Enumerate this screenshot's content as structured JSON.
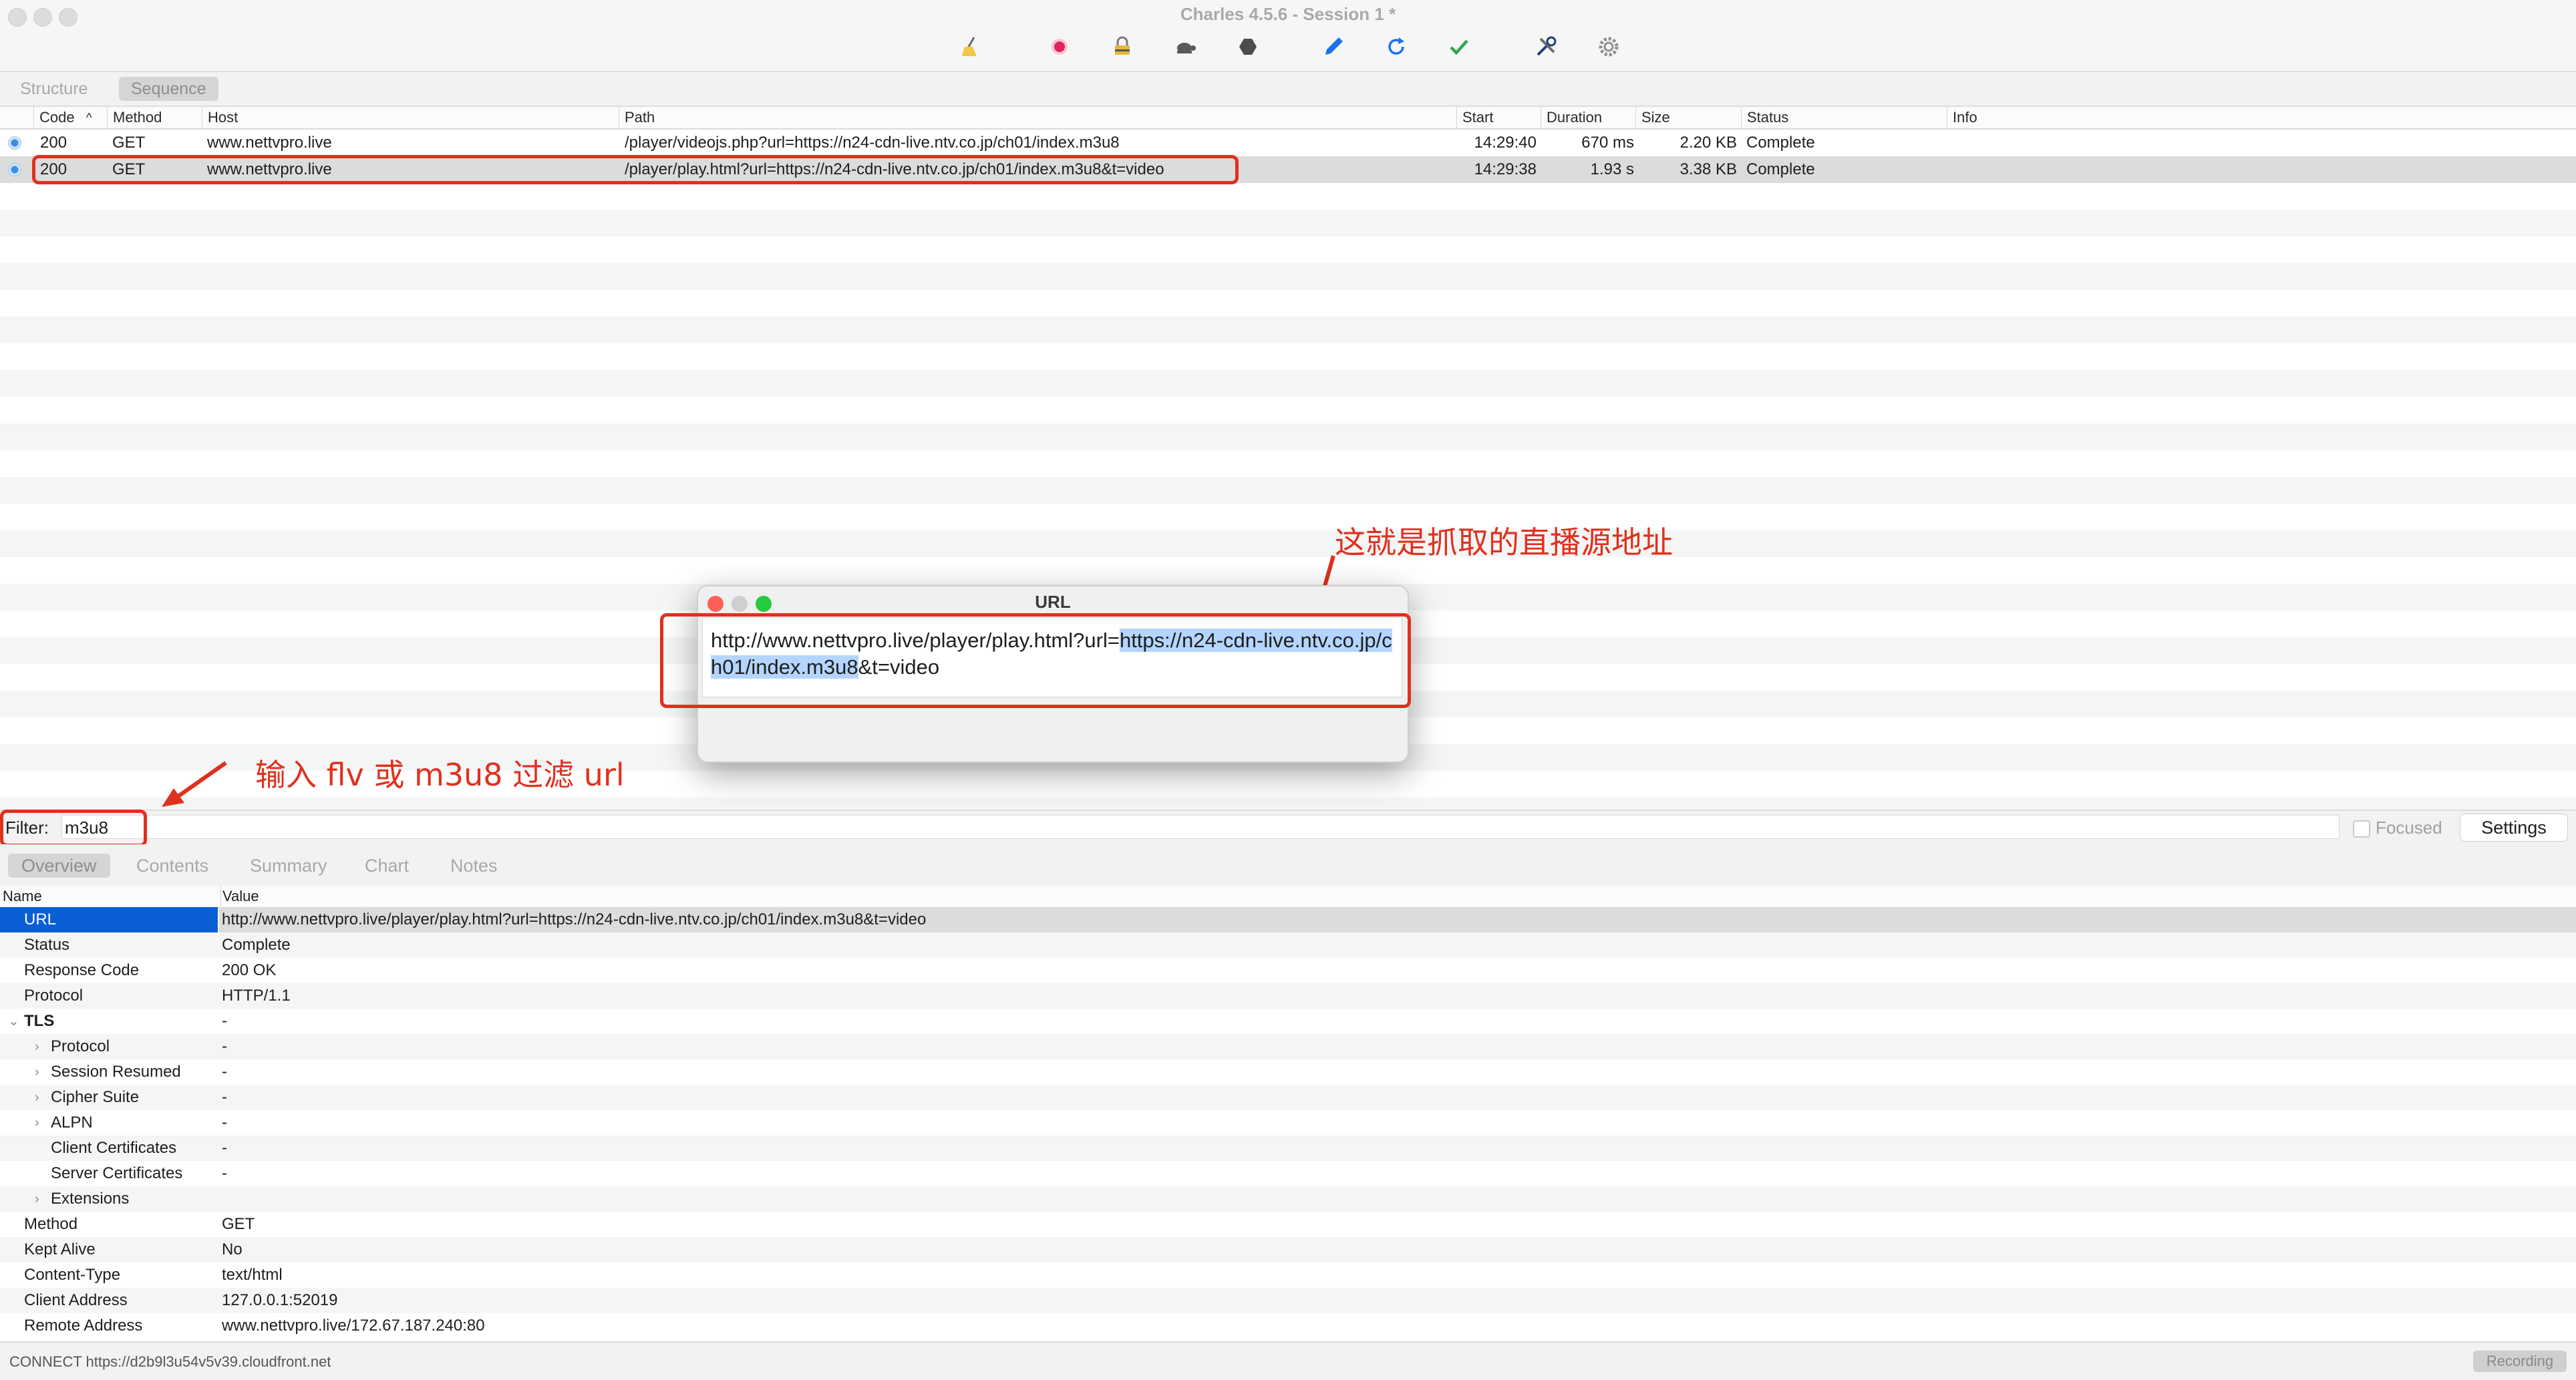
{
  "window": {
    "title": "Charles 4.5.6 - Session 1 *"
  },
  "toolbar": {
    "icons": [
      "broom-icon",
      "record-icon",
      "ssl-lock-icon",
      "throttle-turtle-icon",
      "breakpoint-hexagon-icon",
      "compose-pen-icon",
      "repeat-refresh-icon",
      "validate-check-icon",
      "tools-icon",
      "settings-gear-icon"
    ],
    "colors": {
      "record": "#e0245e",
      "refresh": "#1a73e8",
      "check": "#2ea44f",
      "pen": "#1a73e8"
    }
  },
  "view_tabs": [
    {
      "label": "Structure",
      "active": false
    },
    {
      "label": "Sequence",
      "active": true
    }
  ],
  "request_table": {
    "columns": [
      "Code",
      "Method",
      "Host",
      "Path",
      "Start",
      "Duration",
      "Size",
      "Status",
      "Info"
    ],
    "rows": [
      {
        "code": "200",
        "method": "GET",
        "host": "www.nettvpro.live",
        "path": "/player/videojs.php?url=https://n24-cdn-live.ntv.co.jp/ch01/index.m3u8",
        "start": "14:29:40",
        "duration": "670 ms",
        "size": "2.20 KB",
        "status": "Complete",
        "info": "",
        "selected": false
      },
      {
        "code": "200",
        "method": "GET",
        "host": "www.nettvpro.live",
        "path": "/player/play.html?url=https://n24-cdn-live.ntv.co.jp/ch01/index.m3u8&t=video",
        "start": "14:29:38",
        "duration": "1.93 s",
        "size": "3.38 KB",
        "status": "Complete",
        "info": "",
        "selected": true
      }
    ]
  },
  "annotations": {
    "stream_source": "这就是抓取的直播源地址",
    "filter_hint": "输入 flv 或 m3u8 过滤 url",
    "color": "#e0301e"
  },
  "url_dialog": {
    "title": "URL",
    "text_before": "http://www.nettvpro.live/player/play.html?url=",
    "text_selected": "https://n24-cdn-live.ntv.co.jp/ch01/index.m3u8",
    "text_after": "&t=video"
  },
  "filter": {
    "label": "Filter:",
    "value": "m3u8",
    "focused_label": "Focused",
    "focused_checked": false,
    "settings_label": "Settings"
  },
  "detail_tabs": [
    {
      "label": "Overview",
      "active": true
    },
    {
      "label": "Contents",
      "active": false
    },
    {
      "label": "Summary",
      "active": false
    },
    {
      "label": "Chart",
      "active": false
    },
    {
      "label": "Notes",
      "active": false
    }
  ],
  "detail_table": {
    "columns": [
      "Name",
      "Value"
    ],
    "rows": [
      {
        "name": "URL",
        "value": "http://www.nettvpro.live/player/play.html?url=https://n24-cdn-live.ntv.co.jp/ch01/index.m3u8&t=video",
        "level": 0,
        "expander": "none",
        "bold": false,
        "selected": true
      },
      {
        "name": "Status",
        "value": "Complete",
        "level": 0,
        "expander": "none",
        "bold": false,
        "selected": false
      },
      {
        "name": "Response Code",
        "value": "200 OK",
        "level": 0,
        "expander": "none",
        "bold": false,
        "selected": false
      },
      {
        "name": "Protocol",
        "value": "HTTP/1.1",
        "level": 0,
        "expander": "none",
        "bold": false,
        "selected": false
      },
      {
        "name": "TLS",
        "value": "-",
        "level": 0,
        "expander": "expanded",
        "bold": true,
        "selected": false
      },
      {
        "name": "Protocol",
        "value": "-",
        "level": 1,
        "expander": "collapsed",
        "bold": false,
        "selected": false
      },
      {
        "name": "Session Resumed",
        "value": "-",
        "level": 1,
        "expander": "collapsed",
        "bold": false,
        "selected": false
      },
      {
        "name": "Cipher Suite",
        "value": "-",
        "level": 1,
        "expander": "collapsed",
        "bold": false,
        "selected": false
      },
      {
        "name": "ALPN",
        "value": "-",
        "level": 1,
        "expander": "collapsed",
        "bold": false,
        "selected": false
      },
      {
        "name": "Client Certificates",
        "value": "-",
        "level": 1,
        "expander": "none",
        "bold": false,
        "selected": false
      },
      {
        "name": "Server Certificates",
        "value": "-",
        "level": 1,
        "expander": "none",
        "bold": false,
        "selected": false
      },
      {
        "name": "Extensions",
        "value": "",
        "level": 1,
        "expander": "collapsed",
        "bold": false,
        "selected": false
      },
      {
        "name": "Method",
        "value": "GET",
        "level": 0,
        "expander": "none",
        "bold": false,
        "selected": false
      },
      {
        "name": "Kept Alive",
        "value": "No",
        "level": 0,
        "expander": "none",
        "bold": false,
        "selected": false
      },
      {
        "name": "Content-Type",
        "value": "text/html",
        "level": 0,
        "expander": "none",
        "bold": false,
        "selected": false
      },
      {
        "name": "Client Address",
        "value": "127.0.0.1:52019",
        "level": 0,
        "expander": "none",
        "bold": false,
        "selected": false
      },
      {
        "name": "Remote Address",
        "value": "www.nettvpro.live/172.67.187.240:80",
        "level": 0,
        "expander": "none",
        "bold": false,
        "selected": false
      }
    ]
  },
  "status_bar": {
    "text": "CONNECT https://d2b9l3u54v5v39.cloudfront.net",
    "recording_label": "Recording"
  }
}
